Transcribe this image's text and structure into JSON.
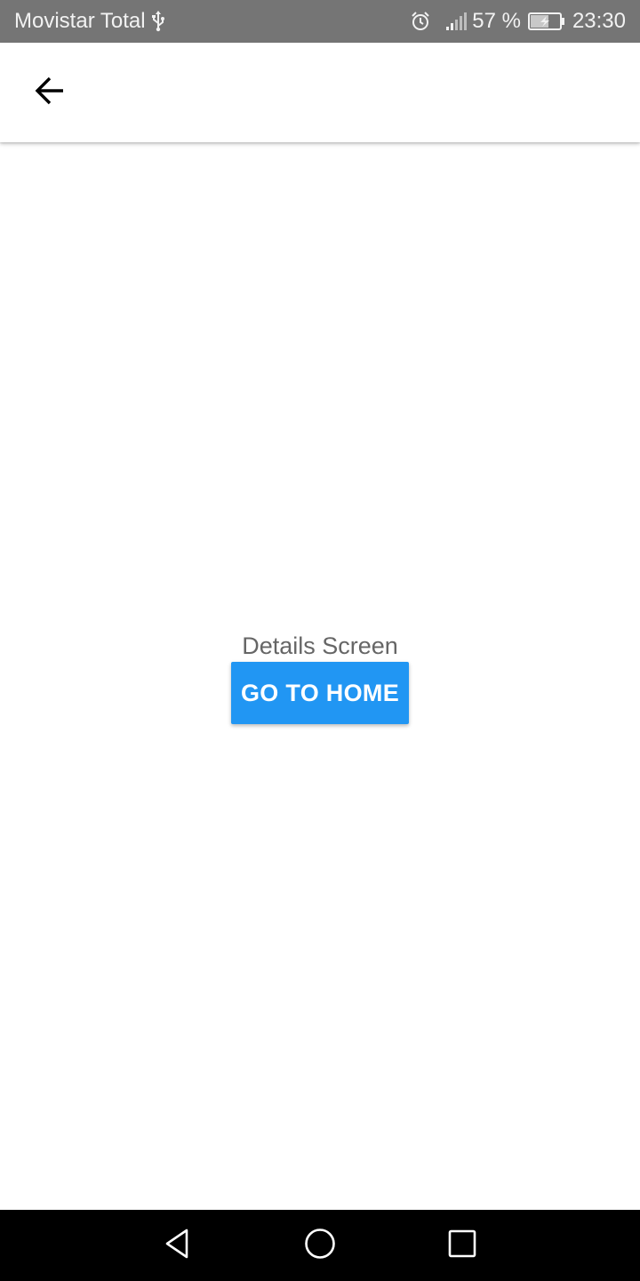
{
  "status_bar": {
    "carrier": "Movistar Total",
    "battery_percent": "57 %",
    "time": "23:30",
    "icons": [
      "usb-icon",
      "alarm-icon",
      "signal-icon",
      "battery-charging-icon"
    ]
  },
  "app_bar": {
    "back_icon": "arrow-back-icon"
  },
  "main": {
    "title": "Details Screen",
    "go_home_label": "GO TO HOME"
  },
  "nav_bar": {
    "icons": [
      "nav-back-icon",
      "nav-home-icon",
      "nav-recents-icon"
    ]
  },
  "colors": {
    "status_bar_bg": "#757575",
    "button_bg": "#2196f3",
    "button_text": "#ffffff",
    "title_text": "#666666",
    "nav_bar_bg": "#000000"
  }
}
